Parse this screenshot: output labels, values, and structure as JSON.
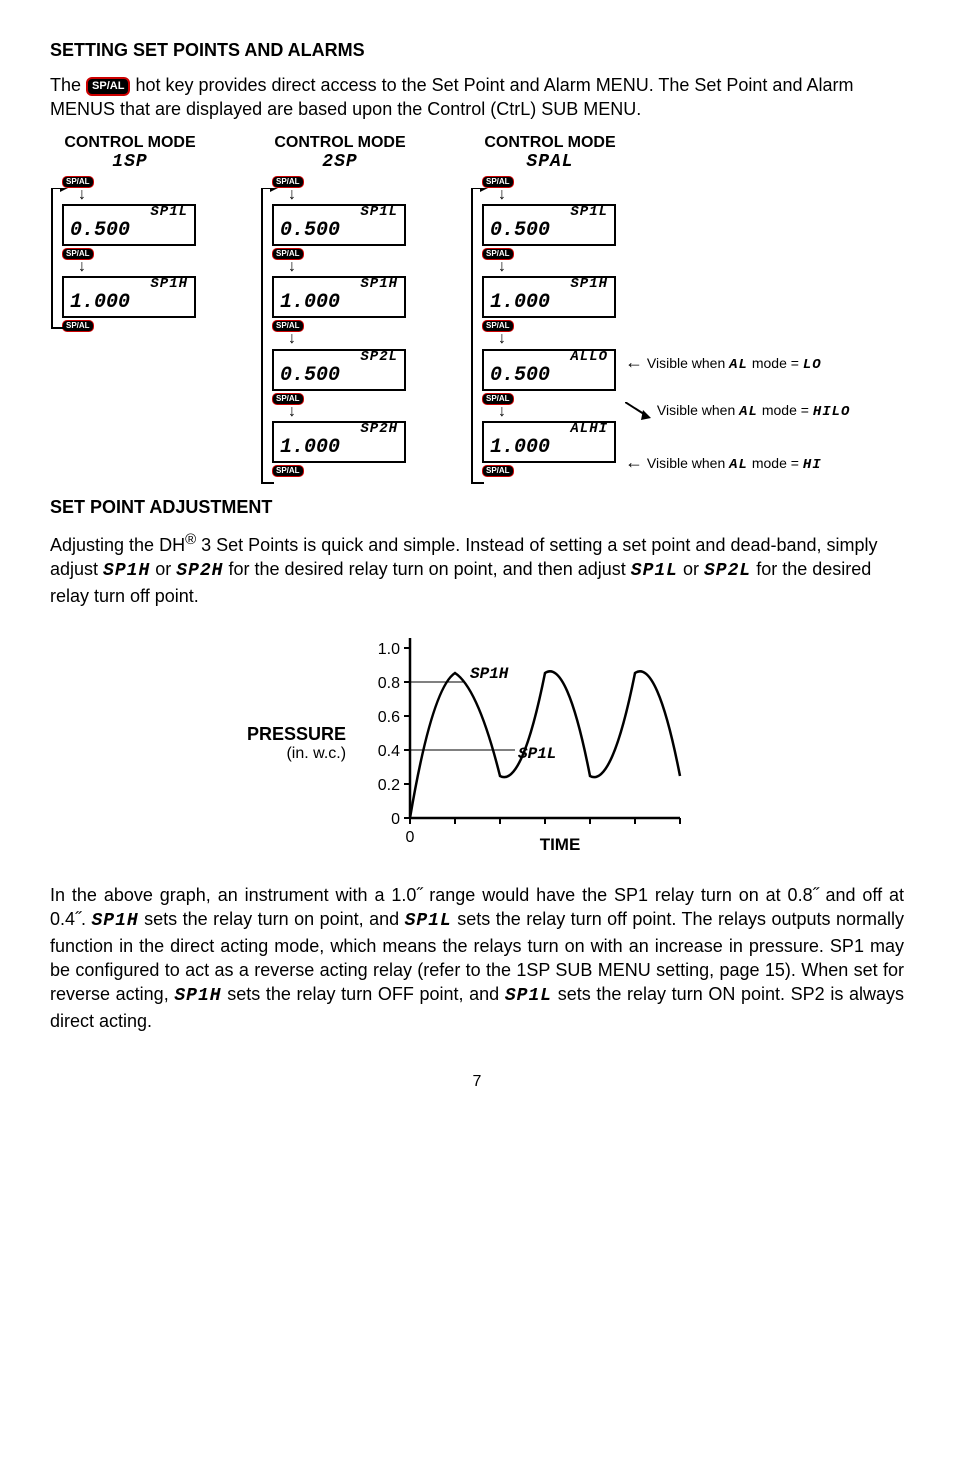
{
  "heading1": "SETTING SET POINTS AND ALARMS",
  "intro": {
    "p1a": "The ",
    "btn": "SP/AL",
    "p1b": " hot key provides direct access to the Set Point and Alarm MENU. The Set Point and Alarm MENUS that are displayed are based upon the Control (CtrL) SUB MENU."
  },
  "modes": {
    "title": "CONTROL MODE",
    "col1": {
      "sub": "1SP",
      "steps": [
        {
          "lbl": "SP1L",
          "val": "0.500"
        },
        {
          "lbl": "SP1H",
          "val": "1.000"
        }
      ]
    },
    "col2": {
      "sub": "2SP",
      "steps": [
        {
          "lbl": "SP1L",
          "val": "0.500"
        },
        {
          "lbl": "SP1H",
          "val": "1.000"
        },
        {
          "lbl": "SP2L",
          "val": "0.500"
        },
        {
          "lbl": "SP2H",
          "val": "1.000"
        }
      ]
    },
    "col3": {
      "sub": "SPAL",
      "steps": [
        {
          "lbl": "SP1L",
          "val": "0.500"
        },
        {
          "lbl": "SP1H",
          "val": "1.000"
        },
        {
          "lbl": "ALLO",
          "val": "0.500"
        },
        {
          "lbl": "ALHI",
          "val": "1.000"
        }
      ],
      "annot": [
        "Visible when AL mode = LO",
        "Visible when AL mode = HILO",
        "Visible when AL mode = HI"
      ]
    }
  },
  "heading2": "SET POINT ADJUSTMENT",
  "adj": {
    "p1a": "Adjusting the DH",
    "reg": "®",
    "p1b": " 3 Set Points is quick and simple. Instead of setting a set point and dead-band, simply adjust ",
    "s1": "SP1H",
    "p1c": " or ",
    "s2": "SP2H",
    "p1d": " for the desired relay turn on point, and then adjust ",
    "s3": "SP1L",
    "p1e": " or ",
    "s4": "SP2L",
    "p1f": " for the desired relay turn off point."
  },
  "chart_data": {
    "type": "line",
    "title": "",
    "xlabel": "TIME",
    "ylabel": "PRESSURE",
    "ylabel_sub": "(in. w.c.)",
    "ylim": [
      0,
      1.0
    ],
    "yticks": [
      0,
      0.2,
      0.4,
      0.6,
      0.8,
      1.0
    ],
    "annotations": [
      {
        "label": "SP1H",
        "y": 0.8
      },
      {
        "label": "SP1L",
        "y": 0.4
      }
    ],
    "x": [
      0,
      0.5,
      1,
      1.5,
      2,
      2.5,
      3,
      3.5,
      4,
      4.5,
      5,
      5.5,
      6
    ],
    "values": [
      0,
      0.6,
      0.85,
      0.55,
      0.25,
      0.55,
      0.85,
      0.55,
      0.25,
      0.55,
      0.85,
      0.55,
      0.25
    ]
  },
  "para2": {
    "t1": "In the above graph, an instrument with a 1.0˝ range would have the SP1 relay turn on at 0.8˝ and off at 0.4˝. ",
    "s1": "SP1H",
    "t2": " sets the relay turn on point, and ",
    "s2": "SP1L",
    "t3": " sets the relay turn off point. The relays outputs normally function in the direct acting mode, which means the relays turn on with an increase in pressure. SP1 may be configured to act as a reverse acting relay (refer to the 1SP SUB MENU setting, page 15). When set for reverse acting, ",
    "s3": "SP1H",
    "t4": " sets the relay turn OFF point, and ",
    "s4": "SP1L",
    "t5": " sets the relay turn ON point. SP2 is always direct acting."
  },
  "pagenum": "7"
}
